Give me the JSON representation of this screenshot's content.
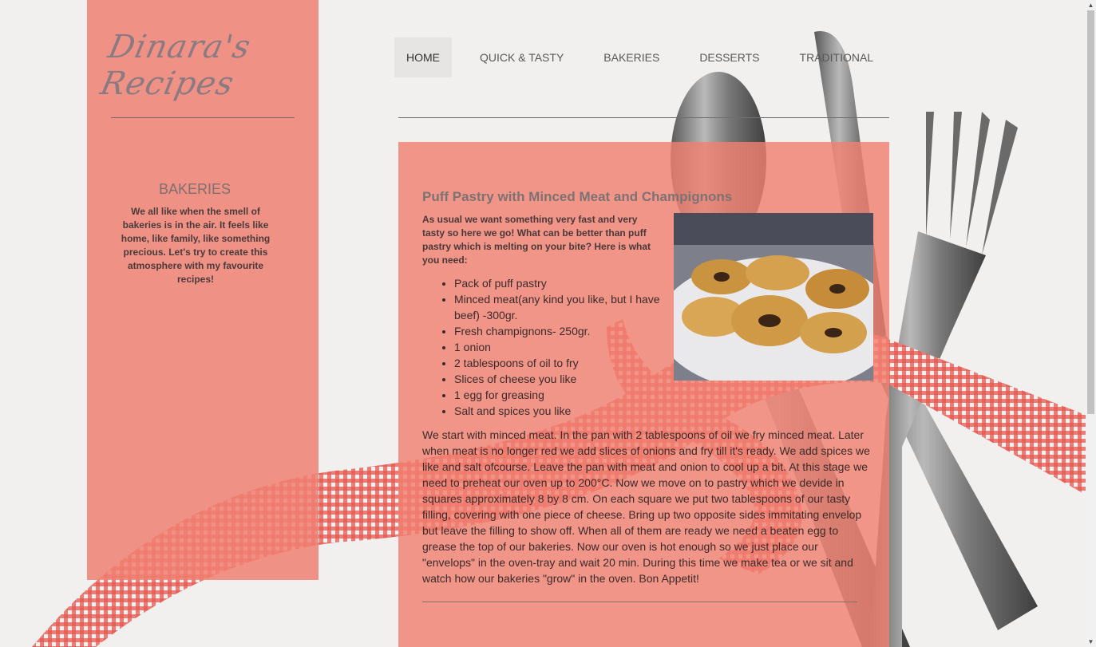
{
  "site": {
    "logo_text": "Dinara's Recipes"
  },
  "nav": {
    "items": [
      {
        "label": "HOME"
      },
      {
        "label": "QUICK & TASTY"
      },
      {
        "label": "BAKERIES"
      },
      {
        "label": "DESSERTS"
      },
      {
        "label": "TRADITIONAL"
      }
    ],
    "active": "HOME"
  },
  "sidebar": {
    "heading": "BAKERIES",
    "text": "We all like when the smell of bakeries is in the air. It feels like home, like family, like something precious. Let's try to create this atmosphere with my favourite recipes!"
  },
  "article": {
    "title": "Puff Pastry with Minced Meat and Champignons",
    "intro": "As usual we want something very fast and very tasty so here we go! What can be better than puff pastry which is melting on your bite? Here is what you need:",
    "ingredients": [
      "Pack of puff pastry",
      "Minced meat(any kind you like, but I have beef) -300gr.",
      "Fresh champignons- 250gr.",
      "1 onion",
      "2 tablespoons of oil to fry",
      "Slices of cheese you like",
      "1 egg for greasing",
      "Salt and spices you like"
    ],
    "body": "We start with minced meat. In the pan with 2 tablespoons of oil we fry minced meat. Later when meat is no longer red we add slices of onions and fry till it's ready. We add spices we like and salt ofcourse. Leave the pan with meat and onion to cool up a bit. At this stage we need to preheat our oven up to 200°C. Now we move on to pastry which we devide in squares approximately 8 by 8 cm. On each square we put two tablespoons of our tasty filling, covering with one piece of cheese. Bring up two opposite sides immitating envelop but leave the filling to show off. When all of them are ready we need a beaten egg to grease the top of our bakeries. Now our oven is hot enough so we just place our \"envelops\" in the oven-tray and wait 20 min. During this time we make tea or we sit and watch how our bakeries \"grow\" in the oven. Bon Appetit!"
  },
  "colors": {
    "panel": "#f08072",
    "ribbon": "#e8413a",
    "background": "#f1f0ee"
  },
  "icons": {
    "scroll_up": "arrow-up-icon",
    "scroll_down": "arrow-down-icon"
  }
}
